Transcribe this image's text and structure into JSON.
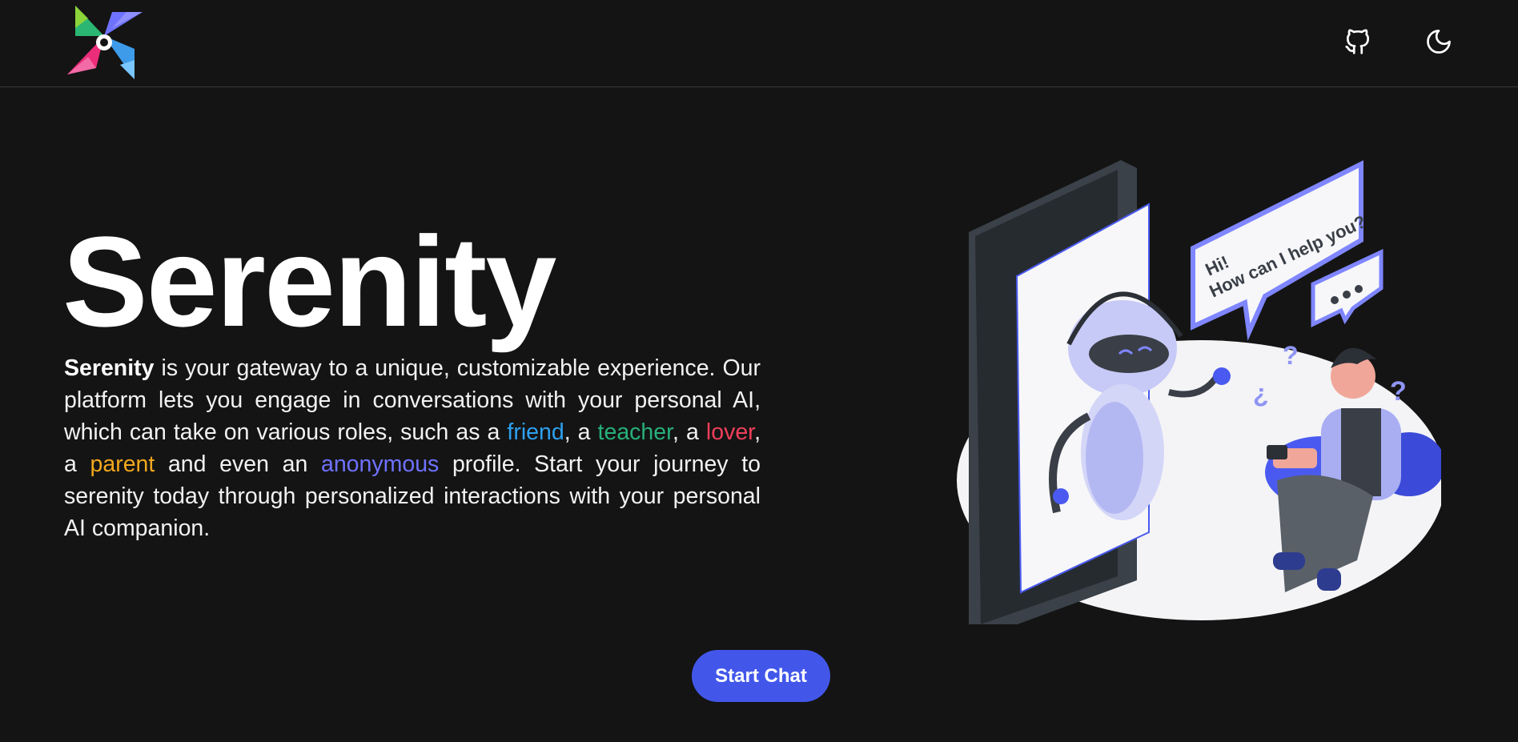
{
  "header": {
    "logo_name": "pinwheel-logo",
    "github_icon": "github-icon",
    "theme_icon": "moon-icon"
  },
  "hero": {
    "title": "Serenity",
    "desc": {
      "brand": "Serenity",
      "part1": " is your gateway to a unique, customizable experience. Our platform lets you engage in conversations with your personal AI, which can take on various roles, such as a ",
      "friend": "friend",
      "sep1": ", a ",
      "teacher": "teacher",
      "sep2": ", a ",
      "lover": "lover",
      "sep3": ", a ",
      "parent": "parent",
      "sep4": " and even an ",
      "anonymous": "anonymous",
      "part2": " profile. Start your journey to serenity today through personalized interactions with your personal AI companion."
    }
  },
  "illustration": {
    "bubble_line1": "Hi!",
    "bubble_line2": "How can I help you?"
  },
  "cta": {
    "label": "Start Chat"
  },
  "colors": {
    "background": "#141414",
    "accent": "#4257ea",
    "friend": "#2ea0f0",
    "teacher": "#27b07a",
    "lover": "#ef3f5a",
    "parent": "#f1a81d",
    "anonymous": "#6f72ff"
  }
}
